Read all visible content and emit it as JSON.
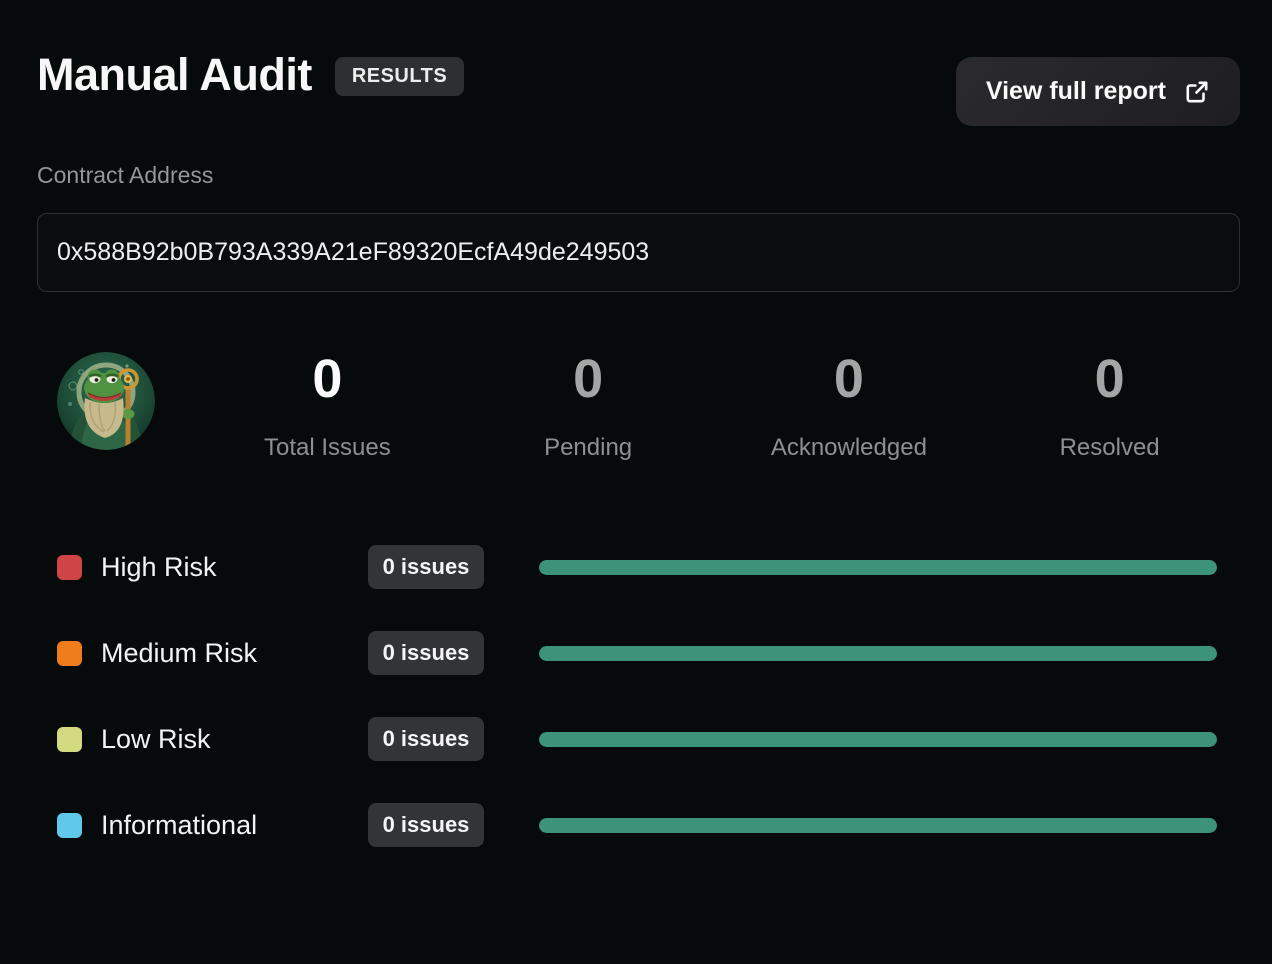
{
  "header": {
    "title": "Manual Audit",
    "badge": "RESULTS",
    "view_report_label": "View full report"
  },
  "contract": {
    "label": "Contract Address",
    "address": "0x588B92b0B793A339A21eF89320EcfA49de249503"
  },
  "stats": [
    {
      "value": "0",
      "label": "Total Issues"
    },
    {
      "value": "0",
      "label": "Pending"
    },
    {
      "value": "0",
      "label": "Acknowledged"
    },
    {
      "value": "0",
      "label": "Resolved"
    }
  ],
  "risk_rows": [
    {
      "label": "High Risk",
      "issues": "0 issues",
      "color": "#cf4444",
      "progress": "100%"
    },
    {
      "label": "Medium Risk",
      "issues": "0 issues",
      "color": "#ef7d1d",
      "progress": "100%"
    },
    {
      "label": "Low Risk",
      "issues": "0 issues",
      "color": "#d4da7f",
      "progress": "100%"
    },
    {
      "label": "Informational",
      "issues": "0 issues",
      "color": "#5fc8eb",
      "progress": "100%"
    }
  ],
  "colors": {
    "bar": "#3d9378",
    "background": "#060a0b",
    "badge_bg": "#323438"
  },
  "icons": {
    "external_link": "external-link-icon",
    "avatar": "pepe-wizard-avatar"
  }
}
